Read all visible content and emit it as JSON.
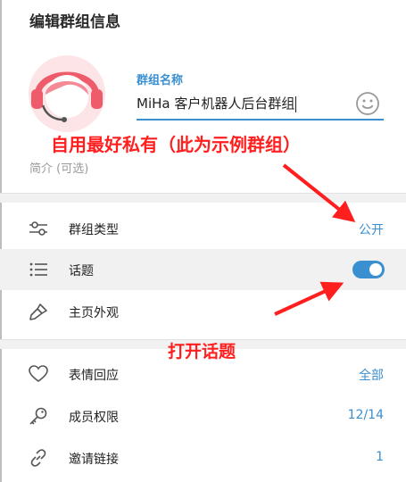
{
  "header": {
    "title": "编辑群组信息"
  },
  "group_name": {
    "label": "群组名称",
    "value": "MiHa 客户机器人后台群组"
  },
  "description": {
    "placeholder": "简介 (可选)"
  },
  "settings": [
    {
      "label": "群组类型",
      "value": "公开"
    },
    {
      "label": "话题",
      "toggle_on": true
    },
    {
      "label": "主页外观"
    }
  ],
  "permissions": [
    {
      "label": "表情回应",
      "value": "全部"
    },
    {
      "label": "成员权限",
      "value": "12/14"
    },
    {
      "label": "邀请链接",
      "value": "1"
    }
  ],
  "annotations": {
    "top": "自用最好私有（此为示例群组）",
    "bottom": "打开话题",
    "color": "#ff1f1f"
  },
  "colors": {
    "accent": "#3a8fd0"
  }
}
